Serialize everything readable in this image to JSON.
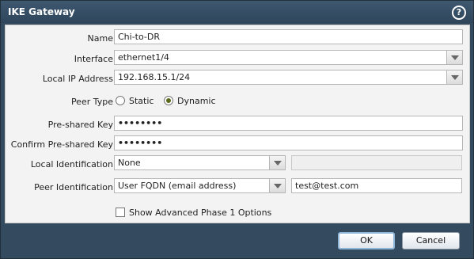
{
  "dialog": {
    "title": "IKE Gateway",
    "help_icon": "?"
  },
  "form": {
    "name": {
      "label": "Name",
      "value": "Chi-to-DR"
    },
    "interface": {
      "label": "Interface",
      "value": "ethernet1/4"
    },
    "local_ip": {
      "label": "Local IP Address",
      "value": "192.168.15.1/24"
    },
    "peer_type": {
      "label": "Peer Type",
      "options": [
        "Static",
        "Dynamic"
      ],
      "selected": "Dynamic"
    },
    "psk": {
      "label": "Pre-shared Key",
      "value": "••••••••"
    },
    "confirm_psk": {
      "label": "Confirm Pre-shared Key",
      "value": "••••••••"
    },
    "local_identification": {
      "label": "Local Identification",
      "type": "None",
      "value": ""
    },
    "peer_identification": {
      "label": "Peer Identification",
      "type": "User FQDN (email address)",
      "value": "test@test.com"
    },
    "advanced": {
      "label": "Show Advanced Phase 1 Options",
      "checked": false
    }
  },
  "buttons": {
    "ok": "OK",
    "cancel": "Cancel"
  },
  "colors": {
    "title_bar": "#334a5f",
    "content_bg": "#f3f3f3",
    "radio_selected": "#5a6a1a"
  }
}
